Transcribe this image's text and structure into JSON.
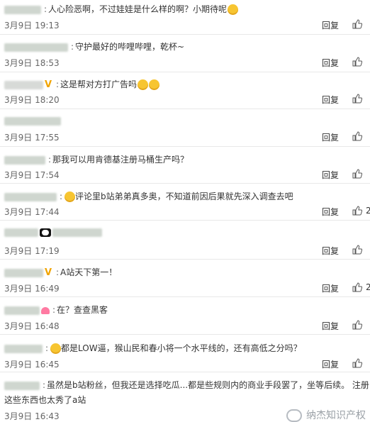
{
  "colors": {
    "separator": "#e8e8e8",
    "text": "#333333",
    "meta": "#666666"
  },
  "reply_label": "回复",
  "comments": [
    {
      "text": "人心险恶啊，不过娃娃是什么样的啊？小期待呢",
      "time": "3月9日 19:13",
      "likes": ""
    },
    {
      "text": "守护最好的哔哩哔哩，乾杯~",
      "time": "3月9日 18:53",
      "likes": ""
    },
    {
      "text": "这是帮对方打广告吗",
      "time": "3月9日 18:20",
      "likes": ""
    },
    {
      "text": "",
      "time": "3月9日 17:55",
      "likes": ""
    },
    {
      "text": "那我可以用肯德基注册马桶生产吗？",
      "time": "3月9日 17:54",
      "likes": ""
    },
    {
      "text": "评论里b站弟弟真多奥，不知道前因后果就先深入调查去吧",
      "time": "3月9日 17:44",
      "likes": "2"
    },
    {
      "text": "",
      "time": "3月9日 17:19",
      "likes": ""
    },
    {
      "text": "A站天下第一！",
      "time": "3月9日 16:49",
      "likes": "2"
    },
    {
      "text": "在？查查黑客",
      "time": "3月9日 16:48",
      "likes": ""
    },
    {
      "text": "都是LOW逼，猴山民和春小将一个水平线的，还有高低之分吗？",
      "time": "3月9日 16:45",
      "likes": ""
    },
    {
      "text": "虽然是b站粉丝，但我还是选择吃瓜...都是些规则内的商业手段罢了，坐等后续。 注册",
      "text2": "这些东西也太秀了a站",
      "time": "3月9日 16:43",
      "likes": ""
    }
  ],
  "watermark": "纳杰知识产权"
}
